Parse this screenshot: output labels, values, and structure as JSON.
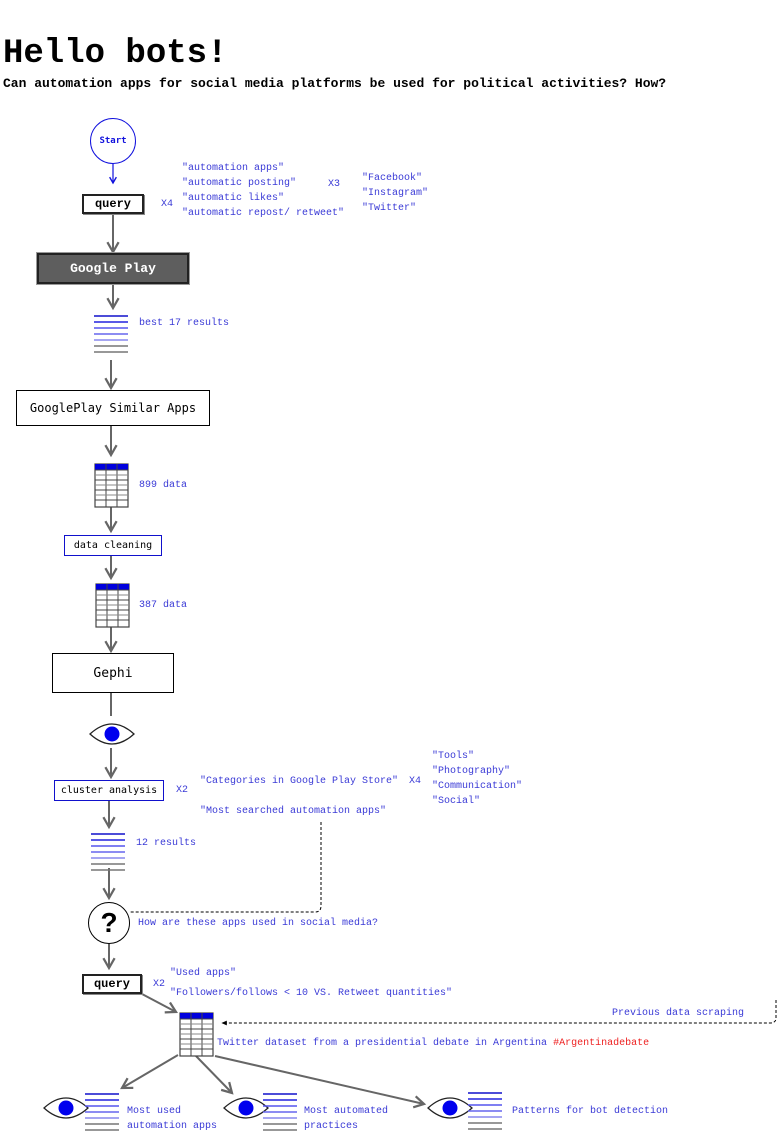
{
  "header": {
    "title": "Hello bots!",
    "subtitle": "Can automation apps for social media platforms be used for political activities? How?"
  },
  "colors": {
    "accent_blue": "#1111dd",
    "note_blue": "#3a3ad6",
    "hashtag_red": "#ee2222",
    "google_play_fill": "#5e5e5e",
    "arrow_grey": "#666666"
  },
  "flow": {
    "start": {
      "label": "Start"
    },
    "query1": {
      "label": "query",
      "multiplier": "X4",
      "terms": [
        "\"automation apps\"",
        "\"automatic posting\"",
        "\"automatic likes\"",
        "\"automatic repost/ retweet\""
      ],
      "platform_multiplier": "X3",
      "platforms": [
        "\"Facebook\"",
        "\"Instagram\"",
        "\"Twitter\""
      ]
    },
    "google_play": {
      "label": "Google Play"
    },
    "results1": {
      "label": "best 17 results",
      "icon": "list-icon"
    },
    "similar_apps": {
      "label": "GooglePlay Similar Apps"
    },
    "data1": {
      "label": "899 data",
      "icon": "table-icon"
    },
    "cleaning": {
      "label": "data cleaning"
    },
    "data2": {
      "label": "387 data",
      "icon": "table-icon"
    },
    "gephi": {
      "label": "Gephi"
    },
    "observe1": {
      "icon": "eye-icon"
    },
    "cluster": {
      "label": "cluster analysis",
      "multiplier": "X2",
      "criteria": [
        "\"Categories in Google Play Store\"",
        "\"Most searched automation apps\""
      ],
      "category_multiplier": "X4",
      "categories": [
        "\"Tools\"",
        "\"Photography\"",
        "\"Communication\"",
        "\"Social\""
      ]
    },
    "results2": {
      "label": "12 results",
      "icon": "list-icon"
    },
    "question": {
      "symbol": "?",
      "label": "How are these apps used in social media?"
    },
    "query2": {
      "label": "query",
      "multiplier": "X2",
      "terms": [
        "\"Used apps\"",
        "\"Followers/follows < 10 VS. Retweet quantities\""
      ]
    },
    "dataset": {
      "label": "Twitter dataset from a presidential debate in Argentina",
      "hashtag": "#Argentinadebate",
      "previous_label": "Previous data scraping"
    },
    "outcomes": [
      {
        "line1": "Most used",
        "line2": "automation apps"
      },
      {
        "line1": "Most automated",
        "line2": "practices"
      },
      {
        "line1": "Patterns for bot detection",
        "line2": ""
      }
    ]
  }
}
